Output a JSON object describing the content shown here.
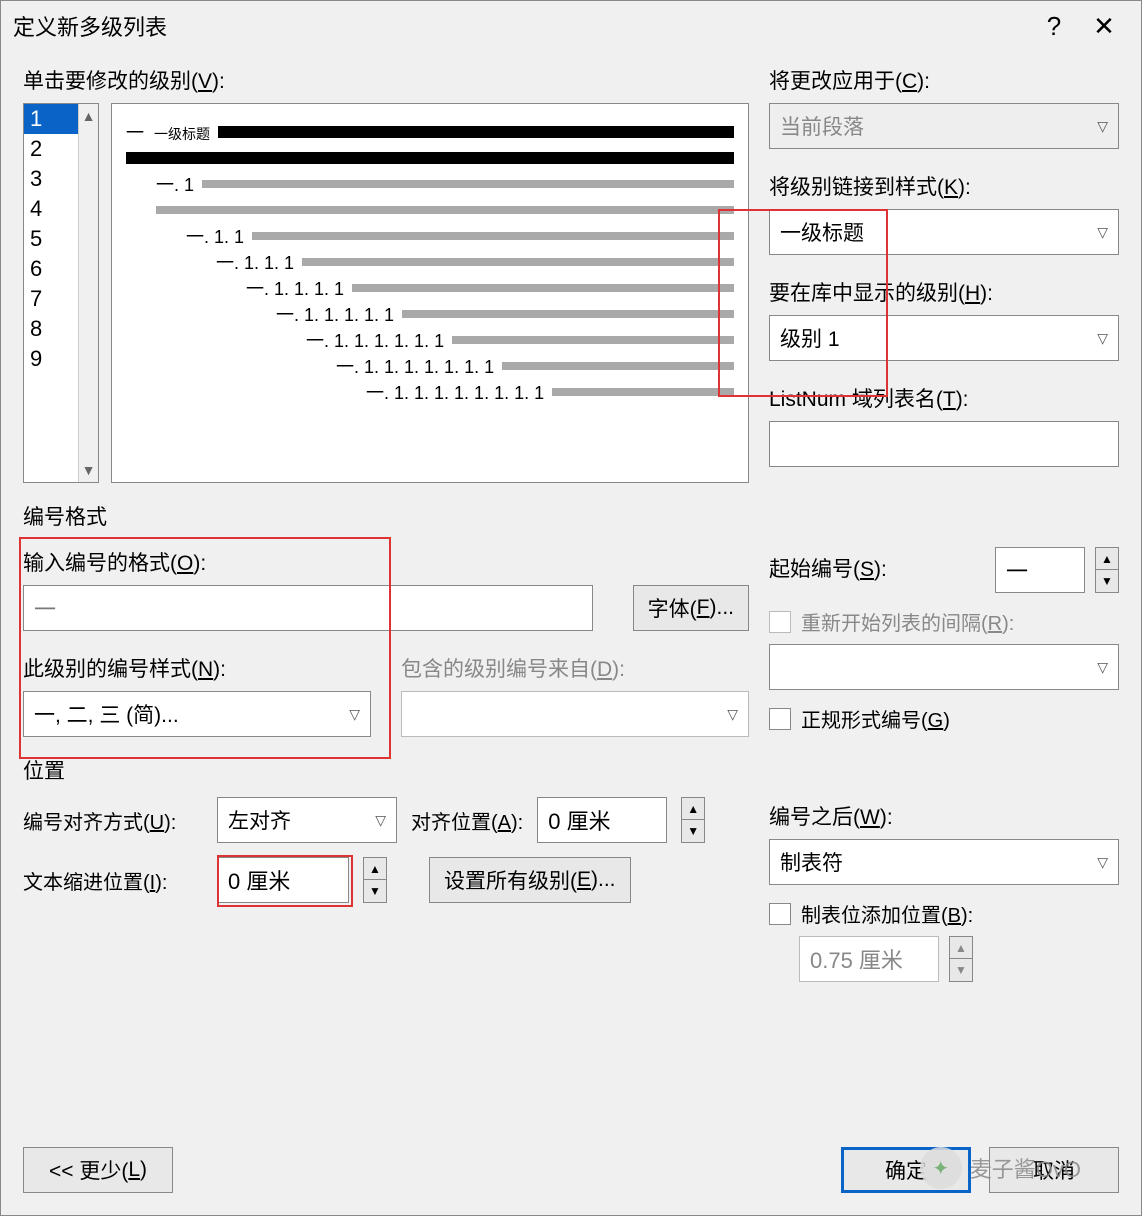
{
  "title": "定义新多级列表",
  "labels": {
    "clickLevel": "单击要修改的级别(V):",
    "applyTo": "将更改应用于(C):",
    "linkStyle": "将级别链接到样式(K):",
    "showInGallery": "要在库中显示的级别(H):",
    "listNum": "ListNum 域列表名(T):",
    "numberFormatSection": "编号格式",
    "enterFormat": "输入编号的格式(O):",
    "fontBtn": "字体(F)...",
    "numberStyle": "此级别的编号样式(N):",
    "includeFrom": "包含的级别编号来自(D):",
    "startAt": "起始编号(S):",
    "restartAfter": "重新开始列表的间隔(R):",
    "legal": "正规形式编号(G)",
    "positionSection": "位置",
    "alignment": "编号对齐方式(U):",
    "alignedAt": "对齐位置(A):",
    "textIndent": "文本缩进位置(I):",
    "setAll": "设置所有级别(E)...",
    "followNumber": "编号之后(W):",
    "tabStop": "制表位添加位置(B):",
    "less": "<< 更少(L)",
    "ok": "确定",
    "cancel": "取消"
  },
  "levels": [
    "1",
    "2",
    "3",
    "4",
    "5",
    "6",
    "7",
    "8",
    "9"
  ],
  "selectedLevel": "1",
  "preview": {
    "l1_num": "一",
    "l1_style": "一级标题",
    "items": [
      "一. 1",
      "一. 1. 1",
      "一. 1. 1. 1",
      "一. 1. 1. 1. 1",
      "一. 1. 1. 1. 1. 1",
      "一. 1. 1. 1. 1. 1. 1",
      "一. 1. 1. 1. 1. 1. 1. 1",
      "一. 1. 1. 1. 1. 1. 1. 1. 1"
    ]
  },
  "applyTo": "当前段落",
  "linkStyle": "一级标题",
  "showInGallery": "级别 1",
  "listNumName": "",
  "formatValue": "一",
  "numberStyleValue": "一, 二, 三 (简)...",
  "includeFromValue": "",
  "startAtValue": "一",
  "restartAfterValue": "",
  "alignmentValue": "左对齐",
  "alignedAtValue": "0 厘米",
  "textIndentValue": "0 厘米",
  "followNumberValue": "制表符",
  "tabStopValue": "0.75 厘米",
  "watermark": "麦子酱OvO"
}
